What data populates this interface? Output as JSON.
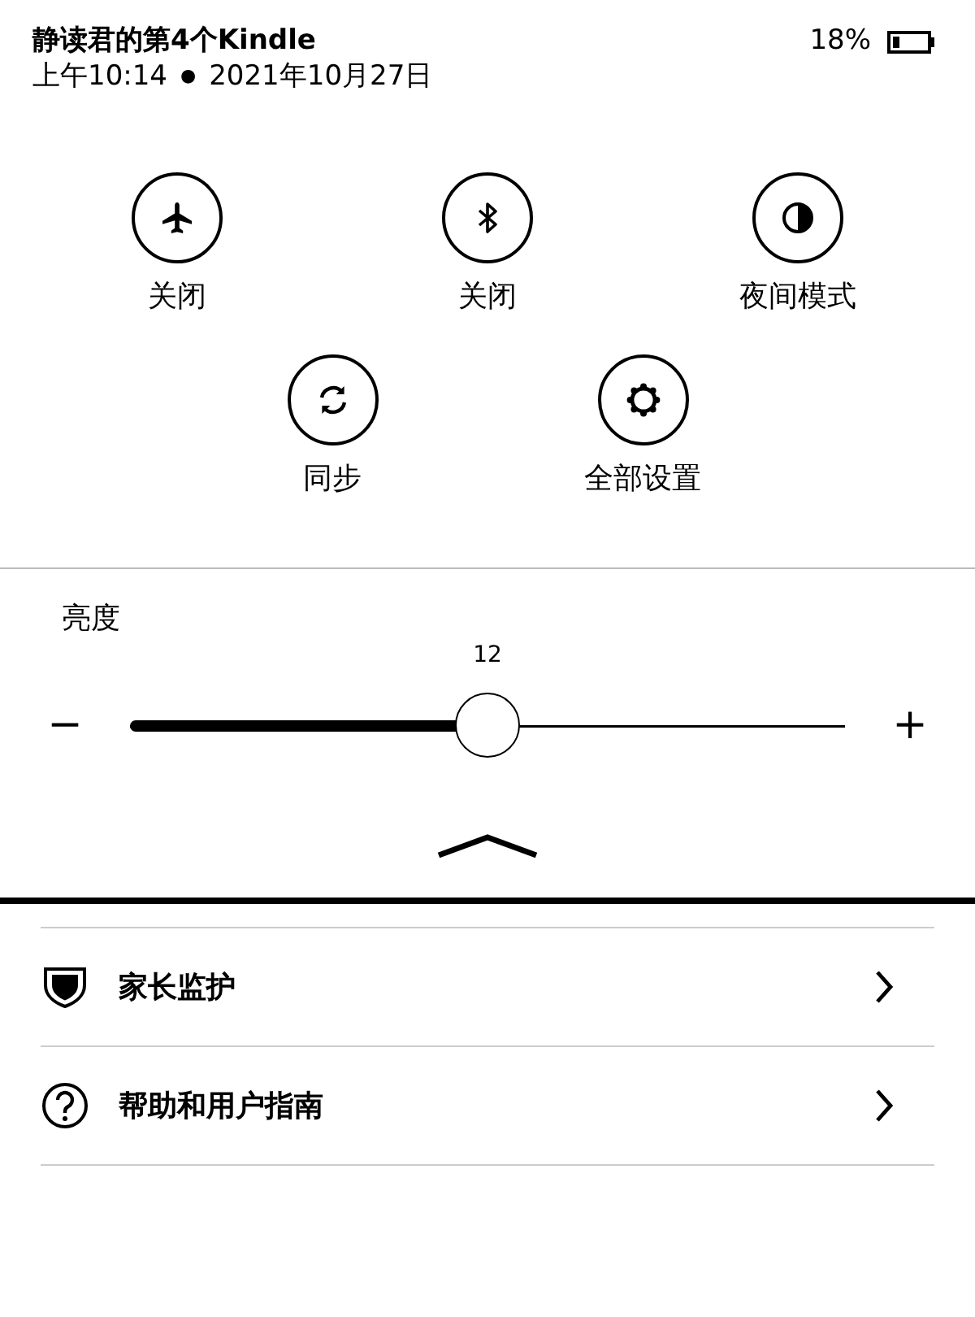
{
  "status": {
    "title": "静读君的第4个Kindle",
    "time": "上午10:14",
    "separator": "●",
    "date": "2021年10月27日",
    "battery": "18%"
  },
  "quick_actions": [
    {
      "kind": "airplane",
      "label": "关闭"
    },
    {
      "kind": "bluetooth",
      "label": "关闭"
    },
    {
      "kind": "night",
      "label": "夜间模式"
    },
    {
      "kind": "sync",
      "label": "同步"
    },
    {
      "kind": "settings",
      "label": "全部设置"
    }
  ],
  "brightness": {
    "label": "亮度",
    "reading": "12",
    "level": 0.5,
    "decrease": "−",
    "increase": "+"
  },
  "menu": [
    {
      "kind": "shield",
      "label": "家长监护"
    },
    {
      "kind": "help",
      "label": "帮助和用户指南"
    }
  ]
}
